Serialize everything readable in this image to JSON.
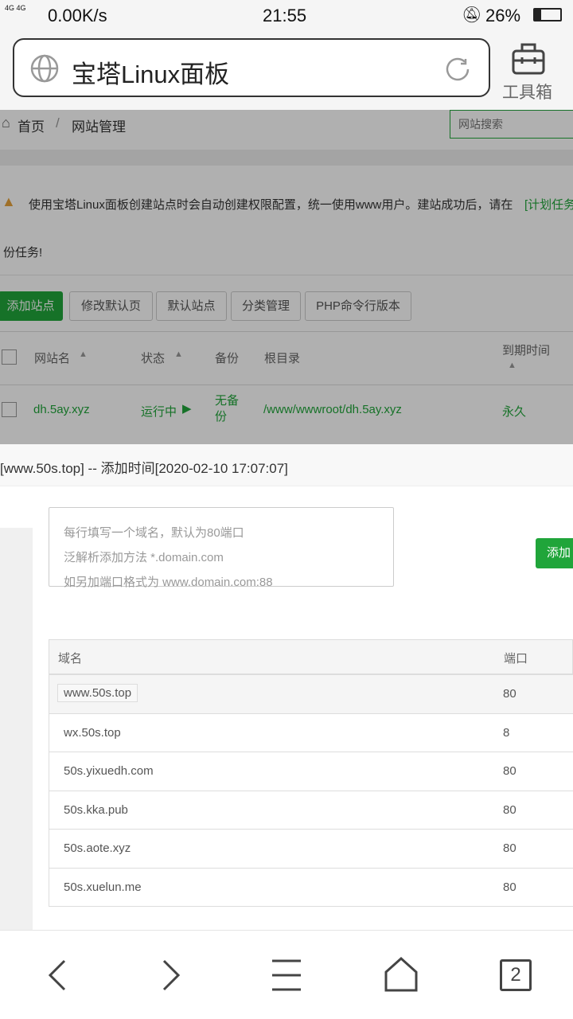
{
  "status": {
    "network": "4G 4G",
    "speed": "0.00K/s",
    "time": "21:55",
    "battery": "26%",
    "battery_level": 26
  },
  "browser": {
    "title": "宝塔Linux面板",
    "toolbox": "工具箱",
    "tabs_count": "2"
  },
  "page": {
    "breadcrumb": [
      "首页",
      "网站管理"
    ],
    "breadcrumb_sep": "/",
    "search_placeholder": "网站搜索",
    "notice": "使用宝塔Linux面板创建站点时会自动创建权限配置，统一使用www用户。建站成功后，请在",
    "notice_link": "[计划任务",
    "notice_cont": "份任务!",
    "buttons": [
      "添加站点",
      "修改默认页",
      "默认站点",
      "分类管理",
      "PHP命令行版本"
    ],
    "table": {
      "headers": [
        "网站名",
        "状态",
        "备份",
        "根目录",
        "到期时间"
      ],
      "rows": [
        {
          "name": "dh.5ay.xyz",
          "status": "运行中",
          "backup": "无备份",
          "root": "/www/wwwroot/dh.5ay.xyz",
          "expire": "永久"
        }
      ]
    }
  },
  "modal": {
    "title": "[www.50s.top] -- 添加时间[2020-02-10 17:07:07]",
    "placeholder_lines": [
      "每行填写一个域名，默认为80端口",
      "泛解析添加方法 *.domain.com",
      "如另加端口格式为 www.domain.com:88"
    ],
    "add_button": "添加",
    "headers": {
      "domain": "域名",
      "port": "端口"
    },
    "rows": [
      {
        "domain": "www.50s.top",
        "port": "80"
      },
      {
        "domain": "wx.50s.top",
        "port": "8"
      },
      {
        "domain": "50s.yixuedh.com",
        "port": "80"
      },
      {
        "domain": "50s.kka.pub",
        "port": "80"
      },
      {
        "domain": "50s.aote.xyz",
        "port": "80"
      },
      {
        "domain": "50s.xuelun.me",
        "port": "80"
      }
    ]
  },
  "colors": {
    "accent": "#20a53a",
    "warning": "#e6a23c"
  }
}
